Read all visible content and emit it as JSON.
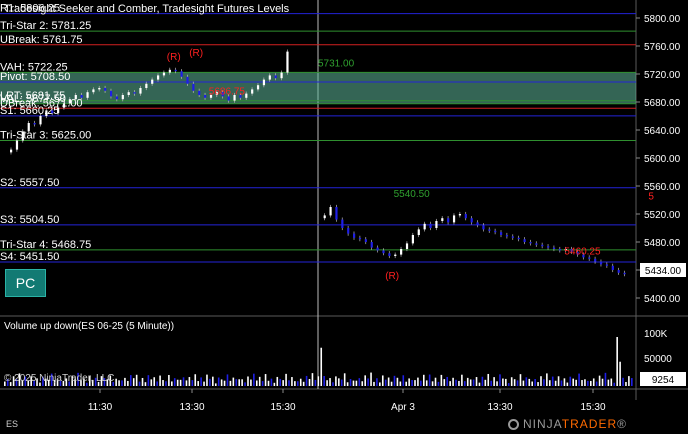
{
  "chart_title": "Tradesight Seeker and Comber, Tradesight Futures Levels",
  "instrument": "ES",
  "indicator_title": "Volume up down(ES 06-25 (5 Minute))",
  "copyright": "© 2025 NinjaTrader, LLC",
  "logo": {
    "ninja": "NINJA",
    "trader": "TRADER",
    "suffix": "®"
  },
  "pc_button": "PC",
  "current_price": "5434.00",
  "current_volume": "9254",
  "price_axis_labels": [
    "5800.00",
    "5760.00",
    "5720.00",
    "5680.00",
    "5640.00",
    "5600.00",
    "5560.00",
    "5520.00",
    "5480.00",
    "5440.00",
    "5400.00"
  ],
  "volume_axis_labels": [
    "100K",
    "50000"
  ],
  "time_axis_labels": [
    "11:30",
    "13:30",
    "15:30",
    "Apr 3",
    "13:30",
    "15:30"
  ],
  "colors": {
    "up_bar": "#ffffff",
    "down_bar": "#1f1fe6",
    "level_blue": "#2323d8",
    "level_green": "#2f8f2f",
    "level_red": "#d22020",
    "value_area": "#5fb89a",
    "signal_red": "#ff2020",
    "signal_green": "#2fa02f",
    "accent_orange": "#ff6a00"
  },
  "levels": [
    {
      "label": "R1: 5806.25",
      "price": 5806.25,
      "kind": "blue",
      "shown": true
    },
    {
      "label": "Tri-Star 2: 5781.25",
      "price": 5781.25,
      "kind": "green",
      "shown": true
    },
    {
      "label": "UBreak: 5761.75",
      "price": 5761.75,
      "kind": "red",
      "shown": true
    },
    {
      "label": "VAH: 5722.25",
      "price": 5722.25,
      "kind": "green",
      "shown": true
    },
    {
      "label": "Pivot: 5708.50",
      "price": 5708.5,
      "kind": "blue",
      "shown": true
    },
    {
      "label": "LRT: 5681.75",
      "price": 5681.75,
      "kind": "green",
      "shown": true
    },
    {
      "label": "VAL: 5677.50",
      "price": 5677.5,
      "kind": "green",
      "shown": true
    },
    {
      "label": "DBreak: 5671.00",
      "price": 5671.0,
      "kind": "red",
      "shown": true
    },
    {
      "label": "S1: 5660.25",
      "price": 5660.25,
      "kind": "blue",
      "shown": true
    },
    {
      "label": "Tri-Star 3: 5625.00",
      "price": 5625.0,
      "kind": "green",
      "shown": true
    },
    {
      "label": "S2: 5557.50",
      "price": 5557.5,
      "kind": "blue",
      "shown": true
    },
    {
      "label": "S3: 5504.50",
      "price": 5504.5,
      "kind": "blue",
      "shown": true
    },
    {
      "label": "Tri-Star 4: 5468.75",
      "price": 5468.75,
      "kind": "green",
      "shown": true
    },
    {
      "label": "S4: 5451.50",
      "price": 5451.5,
      "kind": "blue",
      "shown": true
    }
  ],
  "annotations": [
    {
      "text": "(R)",
      "color": "red",
      "price": 5740,
      "slot": 56
    },
    {
      "text": "(R)",
      "color": "red",
      "price": 5746,
      "slot": 64
    },
    {
      "text": "5731.00",
      "color": "green",
      "price": 5731,
      "slot": 110
    },
    {
      "text": "5686.75",
      "color": "red",
      "price": 5691,
      "slot": 71
    },
    {
      "text": "5540.50",
      "color": "green",
      "price": 5544,
      "slot": 137
    },
    {
      "text": "5",
      "color": "red",
      "price": 5541,
      "slot": 228
    },
    {
      "text": "(R)",
      "color": "red",
      "price": 5427,
      "slot": 134
    },
    {
      "text": "5460.25",
      "color": "red",
      "price": 5462,
      "slot": 198
    }
  ],
  "chart_data": {
    "type": "candlestick",
    "title": "Tradesight Seeker and Comber, Tradesight Futures Levels",
    "instrument": "ES 06-25 (5 Minute)",
    "ylim": [
      5380,
      5820
    ],
    "value_area": [
      5677.5,
      5722.25
    ],
    "series": [
      {
        "name": "price",
        "session": "Apr 2",
        "closes": [
          5612,
          5625,
          5638,
          5650,
          5648,
          5660,
          5668,
          5664,
          5672,
          5678,
          5684,
          5690,
          5686,
          5694,
          5698,
          5700,
          5696,
          5688,
          5684,
          5690,
          5694,
          5692,
          5700,
          5706,
          5712,
          5718,
          5722,
          5726,
          5724,
          5716,
          5706,
          5696,
          5690,
          5686,
          5690,
          5694,
          5688,
          5682,
          5690,
          5686,
          5692,
          5698,
          5704,
          5712,
          5718,
          5714,
          5722,
          5752
        ]
      },
      {
        "name": "price",
        "session": "Apr 3",
        "closes": [
          5518,
          5530,
          5512,
          5500,
          5492,
          5486,
          5484,
          5480,
          5472,
          5468,
          5464,
          5460,
          5462,
          5470,
          5478,
          5490,
          5498,
          5506,
          5500,
          5510,
          5514,
          5508,
          5518,
          5520,
          5514,
          5508,
          5504,
          5498,
          5496,
          5494,
          5490,
          5488,
          5486,
          5484,
          5480,
          5478,
          5476,
          5474,
          5472,
          5470,
          5468,
          5470,
          5466,
          5462,
          5458,
          5456,
          5452,
          5448,
          5446,
          5440,
          5436,
          5434
        ]
      }
    ],
    "volume_ylim": [
      0,
      120000
    ],
    "volume_ticks": [
      "100K",
      "50000"
    ],
    "last_volume": 9254,
    "x_ticks": [
      "11:30",
      "13:30",
      "15:30",
      "Apr 3",
      "13:30",
      "15:30"
    ]
  }
}
